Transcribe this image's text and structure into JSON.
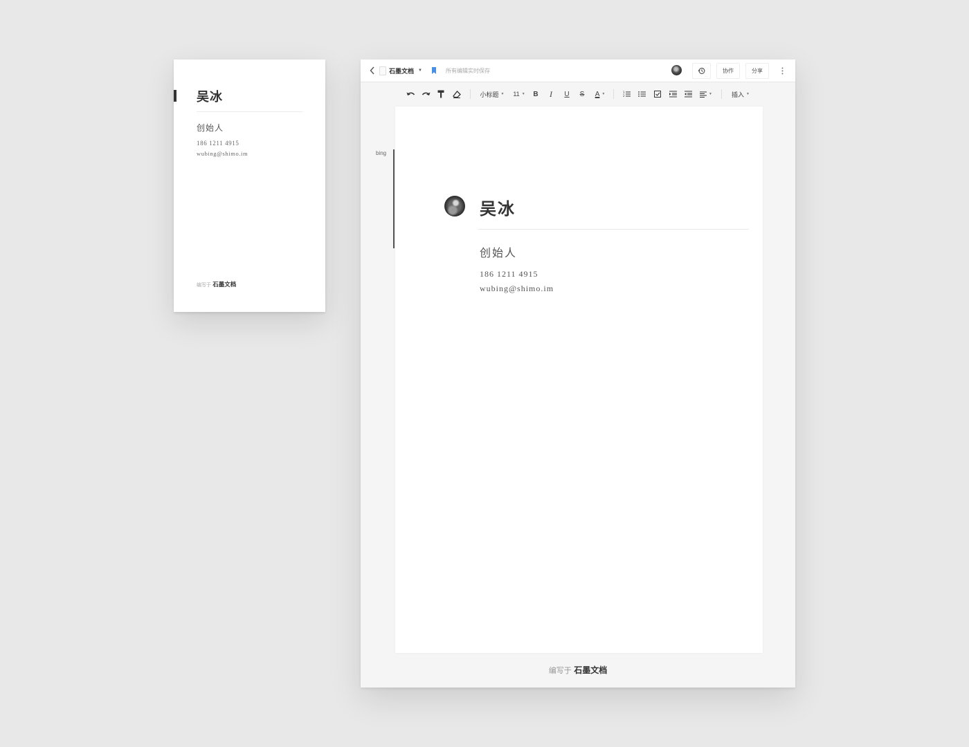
{
  "card": {
    "name": "吴冰",
    "title": "创始人",
    "phone": "186 1211 4915",
    "email": "wubing@shimo.im",
    "footer_prefix": "编写于",
    "footer_brand": "石墨文档"
  },
  "topbar": {
    "doc_title": "石墨文档",
    "save_status": "所有编辑实时保存",
    "collab_label": "协作",
    "share_label": "分享"
  },
  "toolbar": {
    "heading_style": "小标题",
    "font_size": "11",
    "bold_label": "B",
    "italic_label": "I",
    "underline_label": "U",
    "strike_label": "S",
    "font_color_label": "A",
    "insert_label": "插入",
    "icons": [
      "undo-icon",
      "redo-icon",
      "format-painter-icon",
      "eraser-icon",
      "ordered-list-icon",
      "bullet-list-icon",
      "checklist-icon",
      "indent-icon",
      "outdent-icon",
      "align-icon"
    ]
  },
  "document": {
    "cursor_user": "bing",
    "name": "吴冰",
    "title": "创始人",
    "phone": "186 1211 4915",
    "email": "wubing@shimo.im"
  },
  "footer": {
    "prefix": "编写于",
    "brand": "石墨文档"
  },
  "colors": {
    "background": "#e8e8e8",
    "bookmark": "#4a90e2",
    "text_dark": "#333333"
  }
}
